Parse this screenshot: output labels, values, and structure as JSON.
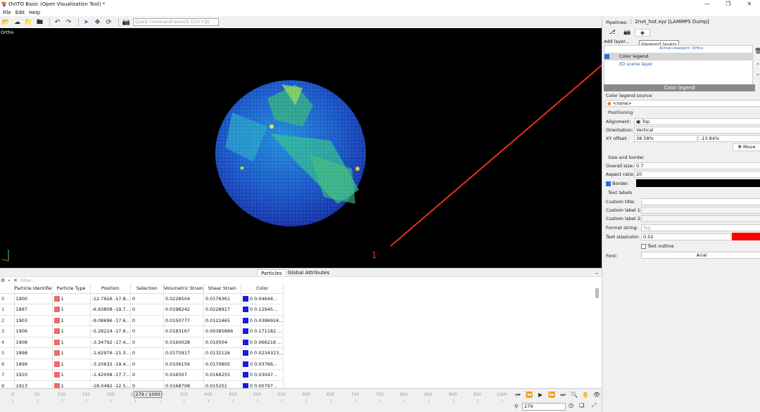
{
  "window": {
    "title": "OVITO Basic (Open Visualization Tool) *",
    "controls": [
      "minimize-icon",
      "maximize-icon",
      "close-icon"
    ]
  },
  "menu": {
    "items": [
      "File",
      "Edit",
      "Help"
    ]
  },
  "toolbar": {
    "icons": [
      "folder-open-icon",
      "cloud-icon",
      "folder-icon",
      "folder-plus-icon",
      "undo-icon",
      "redo-icon",
      "pointer-icon",
      "move-icon",
      "rotate-icon",
      "camera-icon"
    ],
    "quick_command_placeholder": "Quick command search (Ctrl+Q)"
  },
  "viewport": {
    "label": "Ortho",
    "annotation": "1",
    "annotation_color": "#e83020",
    "arrow_color": "#e83020"
  },
  "bottom_tabs": {
    "particles": "Particles",
    "global_attributes": "Global Attributes"
  },
  "filter": {
    "placeholder": "Filter..."
  },
  "table": {
    "columns": [
      "Particle Identifie",
      "Particle Type",
      "Position",
      "Selection",
      "Volumetric Strain",
      "Shear Strain",
      "Color"
    ],
    "type_color": "#f06a6a",
    "color_swatch": "#1a1ae0",
    "rows": [
      {
        "idx": "0",
        "id": "1900",
        "type": "1",
        "pos": "-12.7926 -17.8...",
        "sel": "0",
        "vol": "0.0228504",
        "shear": "0.0176361",
        "color": "0 0.04644..."
      },
      {
        "idx": "1",
        "id": "1897",
        "type": "1",
        "pos": "-6.93808 -19.7...",
        "sel": "0",
        "vol": "0.0198242",
        "shear": "0.0228917",
        "color": "0 0.12945..."
      },
      {
        "idx": "2",
        "id": "1903",
        "type": "1",
        "pos": "-9.08696 -17.6...",
        "sel": "0",
        "vol": "0.0150777",
        "shear": "0.0122465",
        "color": "0 0.0386924..."
      },
      {
        "idx": "3",
        "id": "1906",
        "type": "1",
        "pos": "-5.28224 -17.6...",
        "sel": "0",
        "vol": "0.0183167",
        "shear": "0.00385886",
        "color": "0 0.171182 ..."
      },
      {
        "idx": "4",
        "id": "1908",
        "type": "1",
        "pos": "-3.34792 -17.4...",
        "sel": "0",
        "vol": "0.0160028",
        "shear": "0.010504",
        "color": "0 0.066216 ..."
      },
      {
        "idx": "5",
        "id": "1898",
        "type": "1",
        "pos": "-1.62976 -21.3...",
        "sel": "0",
        "vol": "0.0175917",
        "shear": "0.0132126",
        "color": "0 0.0234323..."
      },
      {
        "idx": "6",
        "id": "1899",
        "type": "1",
        "pos": "-3.20632 -19.4...",
        "sel": "0",
        "vol": "0.0106156",
        "shear": "0.0170805",
        "color": "0 0.03766..."
      },
      {
        "idx": "7",
        "id": "1910",
        "type": "1",
        "pos": "-1.42008 -17.7...",
        "sel": "0",
        "vol": "0.016507",
        "shear": "0.0166255",
        "color": "0 0.03047..."
      },
      {
        "idx": "8",
        "id": "1913",
        "type": "1",
        "pos": "-18.0482 -12.5...",
        "sel": "0",
        "vol": "0.0168708",
        "shear": "0.015201",
        "color": "0 0.00797..."
      }
    ]
  },
  "timeline": {
    "ticks": [
      "0",
      "50",
      "100",
      "150",
      "200",
      "250",
      "300",
      "350",
      "400",
      "450",
      "500",
      "550",
      "600",
      "650",
      "700",
      "750",
      "800",
      "850",
      "900",
      "950",
      "1000"
    ],
    "current": "279 / 1000",
    "frame_value": "279",
    "animation_icons": [
      "go-start-icon",
      "step-back-icon",
      "play-icon",
      "step-forward-icon",
      "go-end-icon"
    ],
    "view_icons": [
      "zoom-icon",
      "pan-icon",
      "orbit-icon",
      "pick-icon",
      "zoom-all-icon",
      "maximize-viewport-icon"
    ]
  },
  "pipeline": {
    "label": "Pipelines:",
    "value": "2nvt_hot.xyz [LAMMPS Dump]",
    "tabs": [
      "pipeline-icon",
      "render-icon",
      "layers-icon"
    ],
    "tooltip": "Viewport layers",
    "add_layer": "Add layer...",
    "active_viewport": "Active viewport: Ortho",
    "layers": [
      {
        "name": "Color legend",
        "checked": true
      },
      {
        "name": "3D scene layer",
        "checked": false
      }
    ]
  },
  "color_legend": {
    "header": "Color legend",
    "source_label": "Color legend source:",
    "source_value": "<none>",
    "positioning": "Positioning",
    "alignment_label": "Alignment:",
    "alignment_value": "Top",
    "orientation_label": "Orientation:",
    "orientation_value": "Vertical",
    "xy_offset_label": "XY offset:",
    "xy_offset_x": "38.58%",
    "xy_offset_y": "-13.84%",
    "move_button": "Move",
    "size_border": "Size and border",
    "overall_size_label": "Overall size:",
    "overall_size_value": "0.7",
    "aspect_ratio_label": "Aspect ratio:",
    "aspect_ratio_value": "20",
    "border_label": "Border:",
    "border_color": "#000000",
    "text_labels": "Text labels",
    "custom_title_label": "Custom title:",
    "custom_label1": "Custom label 1:",
    "custom_label2": "Custom label 2:",
    "format_label": "Format string:",
    "format_value": "%g",
    "text_size_label": "Text size/color:",
    "text_size_value": "0.02",
    "text_color": "#ff0000",
    "text_outline": "Text outline",
    "font_label": "Font:",
    "font_value": "Arial"
  }
}
